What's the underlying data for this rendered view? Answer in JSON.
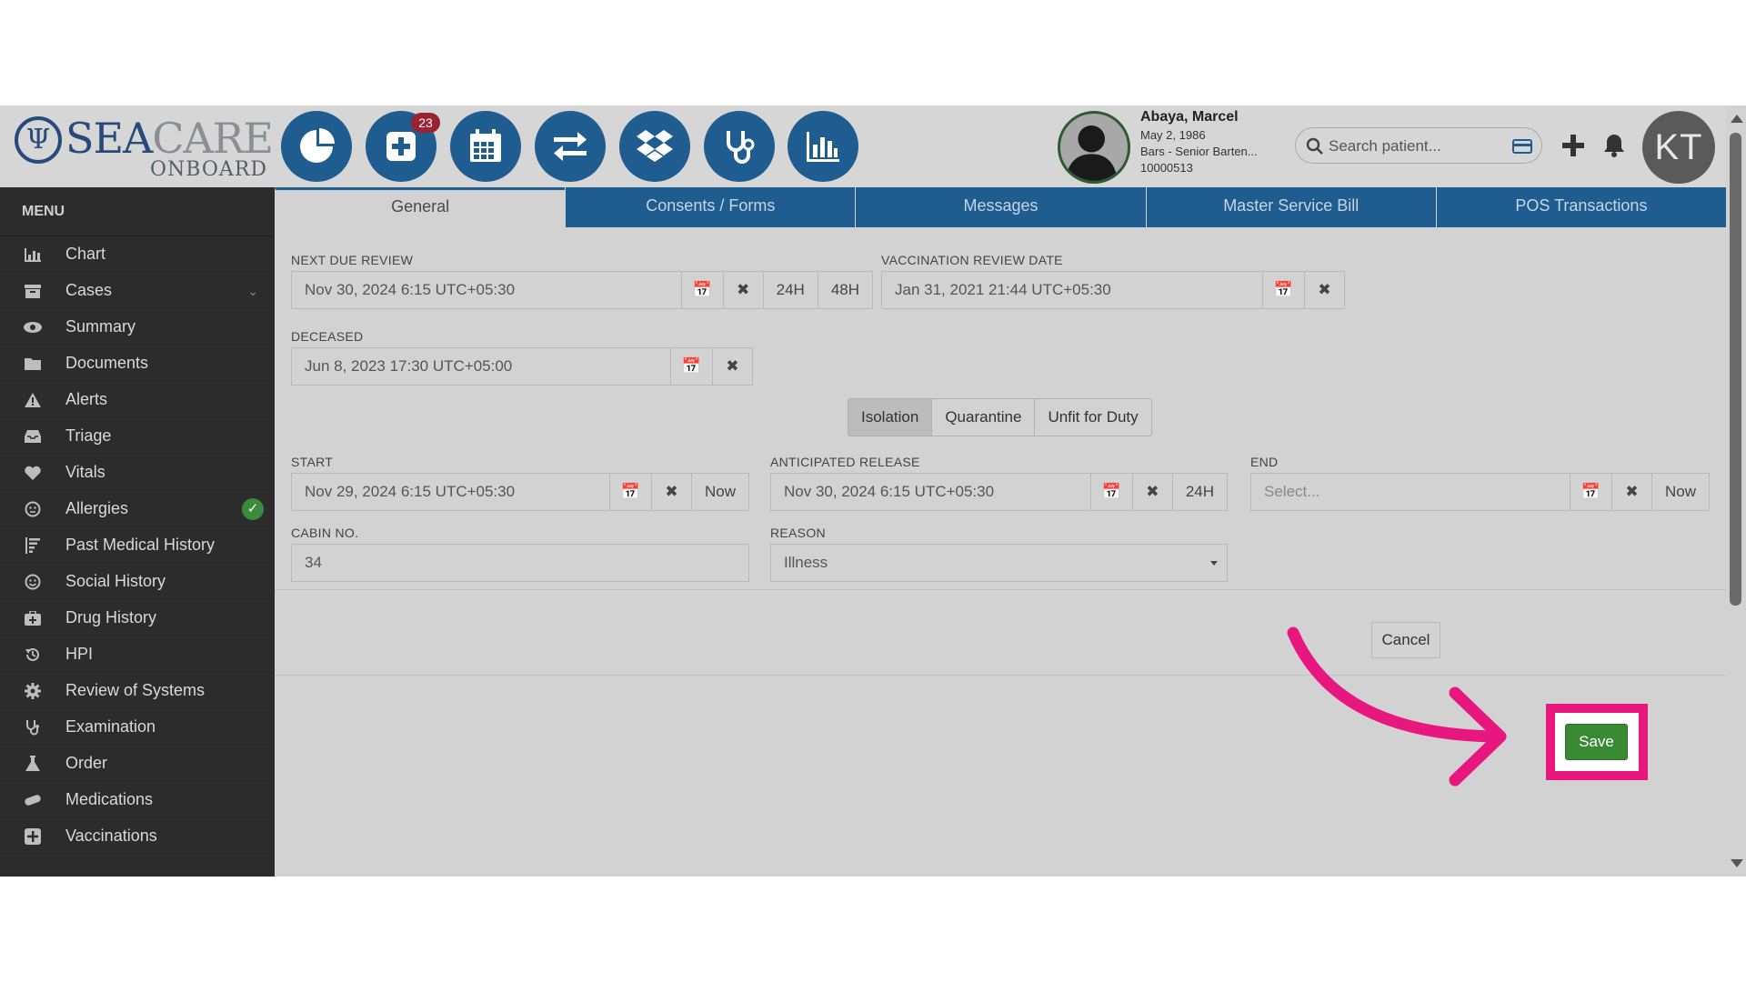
{
  "brand": {
    "name_part1": "SEA",
    "name_part2": "CARE",
    "subtitle": "ONBOARD"
  },
  "toolbar": {
    "badge_count": "23",
    "buttons": [
      "dashboard-pie-icon",
      "add-case-icon",
      "calendar-icon",
      "transfer-icon",
      "dropbox-icon",
      "stethoscope-icon",
      "bar-chart-icon"
    ]
  },
  "patient": {
    "name": "Abaya, Marcel",
    "dob": "May 2, 1986",
    "role": "Bars - Senior Barten...",
    "id": "10000513"
  },
  "search": {
    "placeholder": "Search patient..."
  },
  "user": {
    "initials": "KT"
  },
  "sidebar": {
    "title": "MENU",
    "items": [
      {
        "label": "Chart",
        "icon": "bar-chart-icon"
      },
      {
        "label": "Cases",
        "icon": "cases-icon",
        "expandable": true
      },
      {
        "label": "Summary",
        "icon": "eye-icon"
      },
      {
        "label": "Documents",
        "icon": "folder-icon"
      },
      {
        "label": "Alerts",
        "icon": "warning-icon"
      },
      {
        "label": "Triage",
        "icon": "inbox-icon"
      },
      {
        "label": "Vitals",
        "icon": "heart-icon"
      },
      {
        "label": "Allergies",
        "icon": "face-icon",
        "checked": true
      },
      {
        "label": "Past Medical History",
        "icon": "history-list-icon"
      },
      {
        "label": "Social History",
        "icon": "smile-icon"
      },
      {
        "label": "Drug History",
        "icon": "medkit-icon"
      },
      {
        "label": "HPI",
        "icon": "history-icon"
      },
      {
        "label": "Review of Systems",
        "icon": "gear-icon"
      },
      {
        "label": "Examination",
        "icon": "stethoscope-icon"
      },
      {
        "label": "Order",
        "icon": "flask-icon"
      },
      {
        "label": "Medications",
        "icon": "pill-icon"
      },
      {
        "label": "Vaccinations",
        "icon": "plus-square-icon"
      }
    ]
  },
  "tabs": [
    "General",
    "Consents / Forms",
    "Messages",
    "Master Service Bill",
    "POS Transactions"
  ],
  "form": {
    "next_due_review": {
      "label": "NEXT DUE REVIEW",
      "value": "Nov 30, 2024 6:15 UTC+05:30",
      "quick1": "24H",
      "quick2": "48H"
    },
    "vaccination_review": {
      "label": "VACCINATION REVIEW DATE",
      "value": "Jan 31, 2021 21:44 UTC+05:30"
    },
    "deceased": {
      "label": "DECEASED",
      "value": "Jun 8, 2023 17:30 UTC+05:00"
    },
    "status_options": [
      "Isolation",
      "Quarantine",
      "Unfit for Duty"
    ],
    "start": {
      "label": "START",
      "value": "Nov 29, 2024 6:15 UTC+05:30",
      "now": "Now"
    },
    "anticipated_release": {
      "label": "ANTICIPATED RELEASE",
      "value": "Nov 30, 2024 6:15 UTC+05:30",
      "quick": "24H"
    },
    "end": {
      "label": "END",
      "placeholder": "Select...",
      "now": "Now"
    },
    "cabin": {
      "label": "CABIN NO.",
      "value": "34"
    },
    "reason": {
      "label": "REASON",
      "value": "Illness"
    },
    "save_label": "Save",
    "cancel_label": "Cancel"
  },
  "colors": {
    "primary": "#1f5c8f",
    "highlight": "#e8177f",
    "save": "#3a8a33",
    "sidebar": "#2c2c2c"
  }
}
